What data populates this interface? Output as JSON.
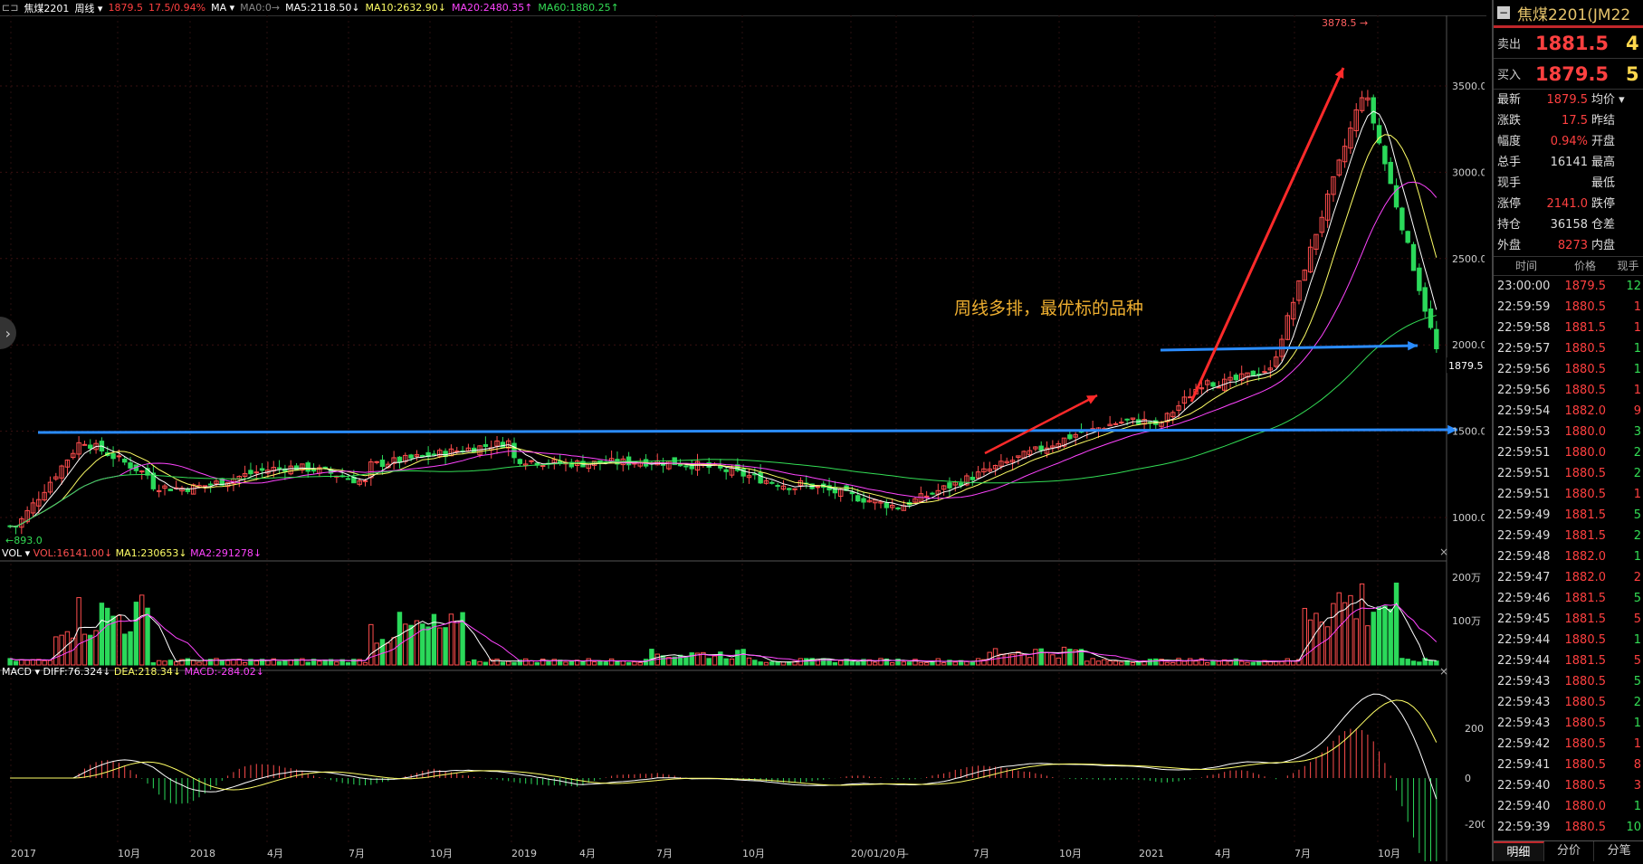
{
  "header": {
    "symbol": "焦煤2201",
    "period": "周线",
    "price": "1879.5",
    "change": "17.5/0.94%",
    "indicator": "MA",
    "ma0": "MA0:0→",
    "ma5": "MA5:2118.50↓",
    "ma10": "MA10:2632.90↓",
    "ma20": "MA20:2480.35↑",
    "ma60": "MA60:1880.25↑"
  },
  "main_chart": {
    "y_ticks": [
      "3500.0",
      "3000.0",
      "2500.0",
      "2000.0",
      "1500.0",
      "1000.0"
    ],
    "high_label": "3878.5",
    "low_label": "893.0",
    "last_price_label": "1879.5",
    "annotation": "周线多排，最优标的品种"
  },
  "vol_panel": {
    "label": "VOL",
    "vol": "VOL:16141.00↓",
    "ma1": "MA1:230653↓",
    "ma2": "MA2:291278↓",
    "y_ticks": [
      "200万",
      "100万"
    ]
  },
  "macd_panel": {
    "label": "MACD",
    "diff": "DIFF:76.324↓",
    "dea": "DEA:218.34↓",
    "macd": "MACD:-284.02↓",
    "y_ticks": [
      "200",
      "0",
      "-200"
    ]
  },
  "x_axis": [
    "2017",
    "10月",
    "2018",
    "4月",
    "7月",
    "10月",
    "2019",
    "4月",
    "7月",
    "10月",
    "20/01/20 —",
    "月",
    "7月",
    "10月",
    "2021",
    "4月",
    "7月",
    "10月"
  ],
  "panel": {
    "title": "焦煤2201(JM22",
    "sell_label": "卖出",
    "sell_price": "1881.5",
    "sell_vol": "4",
    "buy_label": "买入",
    "buy_price": "1879.5",
    "buy_vol": "5",
    "quote": [
      {
        "l": "最新",
        "v": "1879.5",
        "r": "均价 ▾",
        "c": "red"
      },
      {
        "l": "涨跌",
        "v": "17.5",
        "r": "昨结",
        "c": "red"
      },
      {
        "l": "幅度",
        "v": "0.94%",
        "r": "开盘",
        "c": "red"
      },
      {
        "l": "总手",
        "v": "16141",
        "r": "最高",
        "c": "white"
      },
      {
        "l": "现手",
        "v": "",
        "r": "最低",
        "c": "white"
      },
      {
        "l": "涨停",
        "v": "2141.0",
        "r": "跌停",
        "c": "red"
      },
      {
        "l": "持仓",
        "v": "36158",
        "r": "仓差",
        "c": "white"
      },
      {
        "l": "外盘",
        "v": "8273",
        "r": "内盘",
        "c": "red"
      }
    ],
    "ticks_header": [
      "时间",
      "价格",
      "现手"
    ],
    "ticks": [
      {
        "t": "23:00:00",
        "p": "1879.5",
        "v": "12",
        "g": true
      },
      {
        "t": "22:59:59",
        "p": "1880.5",
        "v": "1",
        "g": false
      },
      {
        "t": "22:59:58",
        "p": "1881.5",
        "v": "1",
        "g": false
      },
      {
        "t": "22:59:57",
        "p": "1880.5",
        "v": "1",
        "g": true
      },
      {
        "t": "22:59:56",
        "p": "1880.5",
        "v": "1",
        "g": true
      },
      {
        "t": "22:59:56",
        "p": "1880.5",
        "v": "1",
        "g": false
      },
      {
        "t": "22:59:54",
        "p": "1882.0",
        "v": "9",
        "g": false
      },
      {
        "t": "22:59:53",
        "p": "1880.0",
        "v": "3",
        "g": true
      },
      {
        "t": "22:59:51",
        "p": "1880.0",
        "v": "2",
        "g": true
      },
      {
        "t": "22:59:51",
        "p": "1880.5",
        "v": "2",
        "g": true
      },
      {
        "t": "22:59:51",
        "p": "1880.5",
        "v": "1",
        "g": false
      },
      {
        "t": "22:59:49",
        "p": "1881.5",
        "v": "5",
        "g": true
      },
      {
        "t": "22:59:49",
        "p": "1881.5",
        "v": "2",
        "g": true
      },
      {
        "t": "22:59:48",
        "p": "1882.0",
        "v": "1",
        "g": true
      },
      {
        "t": "22:59:47",
        "p": "1882.0",
        "v": "2",
        "g": false
      },
      {
        "t": "22:59:46",
        "p": "1881.5",
        "v": "5",
        "g": true
      },
      {
        "t": "22:59:45",
        "p": "1881.5",
        "v": "5",
        "g": false
      },
      {
        "t": "22:59:44",
        "p": "1880.5",
        "v": "1",
        "g": true
      },
      {
        "t": "22:59:44",
        "p": "1881.5",
        "v": "5",
        "g": false
      },
      {
        "t": "22:59:43",
        "p": "1880.5",
        "v": "5",
        "g": true
      },
      {
        "t": "22:59:43",
        "p": "1880.5",
        "v": "2",
        "g": true
      },
      {
        "t": "22:59:43",
        "p": "1880.5",
        "v": "1",
        "g": true
      },
      {
        "t": "22:59:42",
        "p": "1880.5",
        "v": "1",
        "g": false
      },
      {
        "t": "22:59:41",
        "p": "1880.5",
        "v": "8",
        "g": false
      },
      {
        "t": "22:59:40",
        "p": "1880.5",
        "v": "3",
        "g": false
      },
      {
        "t": "22:59:40",
        "p": "1880.0",
        "v": "1",
        "g": true
      },
      {
        "t": "22:59:39",
        "p": "1880.5",
        "v": "10",
        "g": true
      }
    ],
    "tabs": [
      "明细",
      "分价",
      "分笔"
    ]
  },
  "colors": {
    "up": "#ff4d4d",
    "down": "#2bd95a",
    "blue_line": "#2a8cff",
    "red_arrow": "#ff2a2a",
    "ma5": "#ffffff",
    "ma10": "#ffff66",
    "ma20": "#ff44ff",
    "ma60": "#33dd55"
  }
}
